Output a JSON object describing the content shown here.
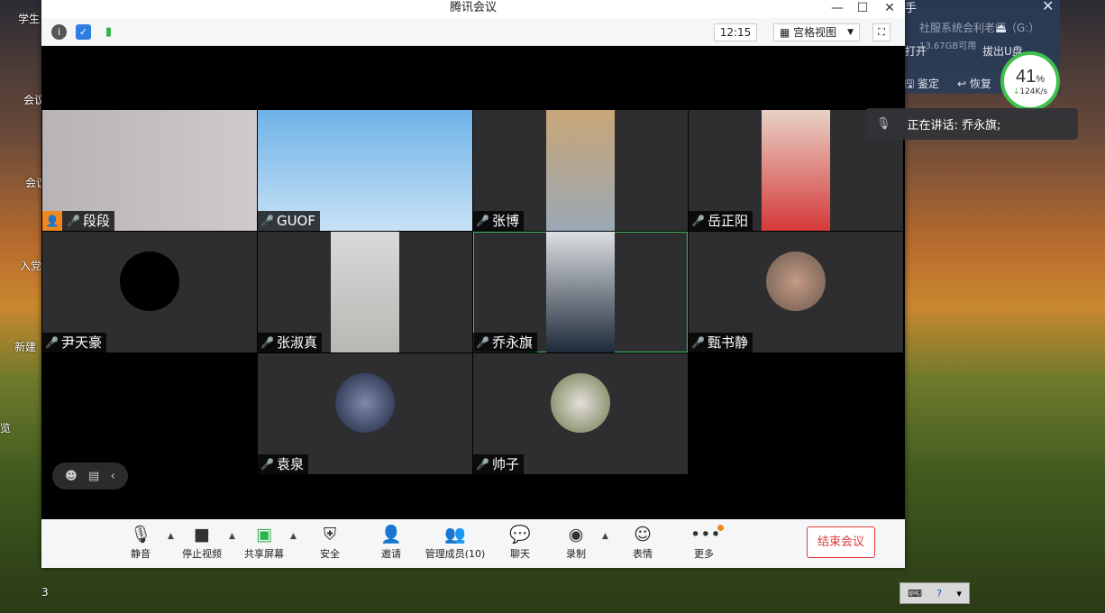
{
  "window": {
    "title": "腾讯会议"
  },
  "top_toolbar": {
    "clock": "12:15",
    "view_label": "宫格视图"
  },
  "desktop": {
    "icons": [
      "学生",
      "会议",
      "入党",
      "新建",
      "览",
      "会议"
    ],
    "taskbar_badge": "3"
  },
  "assistant": {
    "title": "手",
    "line1": "社服系统会利老师（G:）",
    "line2": "13.67GB可用",
    "open_label": "打开",
    "eject_label": "拔出U盘",
    "btn_verify": "鉴定",
    "btn_restore": "恢复",
    "gauge_pct": "41",
    "gauge_unit": "%",
    "gauge_speed": "124K/s"
  },
  "speaker_tip": {
    "text": "正在讲话: 乔永旗;"
  },
  "participants": [
    {
      "name": "段段",
      "mic": "on",
      "host": true
    },
    {
      "name": "GUOF",
      "mic": "off"
    },
    {
      "name": "张博",
      "mic": "off"
    },
    {
      "name": "岳正阳",
      "mic": "on"
    },
    {
      "name": "尹天豪",
      "mic": "on"
    },
    {
      "name": "张淑真",
      "mic": "off"
    },
    {
      "name": "乔永旗",
      "mic": "talking"
    },
    {
      "name": "甄书静",
      "mic": "on"
    },
    {
      "name": "袁泉",
      "mic": "off"
    },
    {
      "name": "帅子",
      "mic": "off"
    }
  ],
  "bottom_toolbar": {
    "mute": "静音",
    "stop_video": "停止视频",
    "share_screen": "共享屏幕",
    "security": "安全",
    "invite": "邀请",
    "manage_members": "管理成员(10)",
    "chat": "聊天",
    "record": "录制",
    "reactions": "表情",
    "more": "更多",
    "end_meeting": "结束会议"
  },
  "colors": {
    "accent_green": "#3fbf5a",
    "danger": "#e23a3a",
    "host_orange": "#f0871f"
  }
}
